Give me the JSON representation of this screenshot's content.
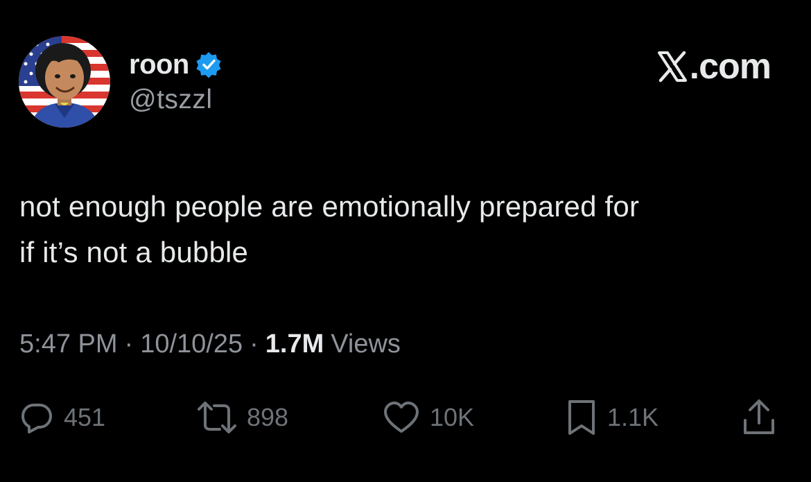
{
  "author": {
    "display_name": "roon",
    "handle": "@tszzl",
    "verified": true,
    "verified_color": "#1d9bf0"
  },
  "brand": {
    "label": ".com",
    "icon": "x-logo-icon"
  },
  "tweet": {
    "text_line1": "not enough people are emotionally prepared for",
    "text_line2": "if it’s not a bubble"
  },
  "meta": {
    "time": "5:47 PM",
    "separator": "·",
    "date": "10/10/25",
    "views_count": "1.7M",
    "views_label": "Views"
  },
  "actions": {
    "replies": "451",
    "reposts": "898",
    "likes": "10K",
    "bookmarks": "1.1K"
  },
  "icons": {
    "reply": "reply-icon",
    "repost": "repost-icon",
    "like": "heart-icon",
    "bookmark": "bookmark-icon",
    "share": "share-icon"
  },
  "colors": {
    "background": "#000000",
    "text": "#e7e9ea",
    "secondary": "#8f9399",
    "action": "#6e7378"
  }
}
